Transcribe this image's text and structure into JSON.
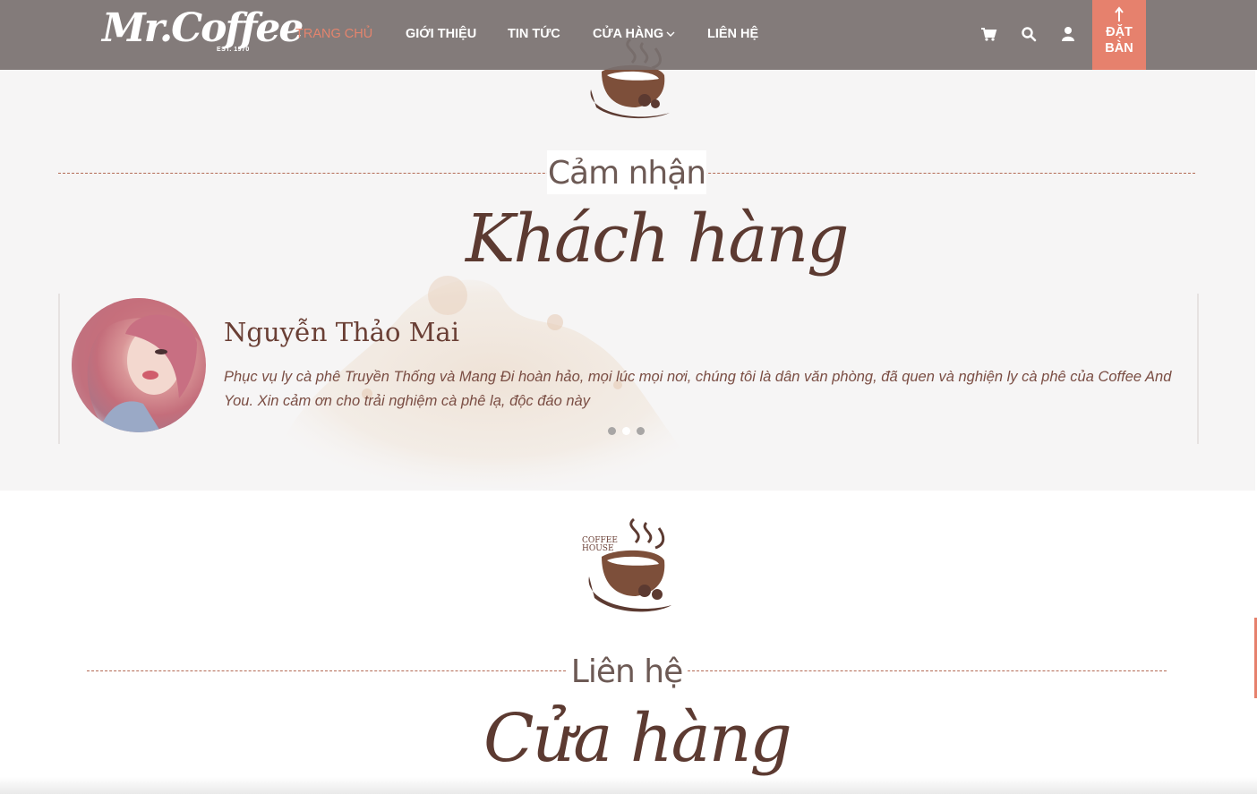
{
  "brand": {
    "logo_text": "Mr.Coffee",
    "logo_est": "EST. 1970"
  },
  "nav": {
    "items": [
      {
        "label": "TRANG CHỦ",
        "active": true
      },
      {
        "label": "GIỚI THIỆU",
        "active": false
      },
      {
        "label": "TIN TỨC",
        "active": false
      },
      {
        "label": "CỬA HÀNG",
        "active": false,
        "has_dropdown": true
      },
      {
        "label": "LIÊN HỆ",
        "active": false
      }
    ],
    "icons": [
      "cart-icon",
      "search-icon",
      "user-icon"
    ],
    "book_button": {
      "label": "ĐẶT BÀN",
      "icon": "arrow-up-icon"
    }
  },
  "cup_logo": {
    "line1": "COFFEE",
    "line2": "HOUSE"
  },
  "testimonials": {
    "subtitle": "Cảm nhận",
    "title": "Khách hàng",
    "active_index": 1,
    "slide_count": 3,
    "current": {
      "name": "Nguyễn Thảo Mai",
      "quote": "Phục vụ ly cà phê Truyền Thống và Mang Đi hoàn hảo, mọi lúc mọi nơi, chúng tôi là dân văn phòng, đã quen và nghiện ly cà phê của Coffee And You. Xin cảm ơn cho trải nghiệm cà phê lạ, độc đáo này"
    }
  },
  "contact": {
    "subtitle": "Liên hệ",
    "title": "Cửa hàng"
  },
  "colors": {
    "header_bg": "#7a7170",
    "accent": "#e6816d",
    "brown": "#5c3a31",
    "section_bg": "#f6f5f5"
  }
}
